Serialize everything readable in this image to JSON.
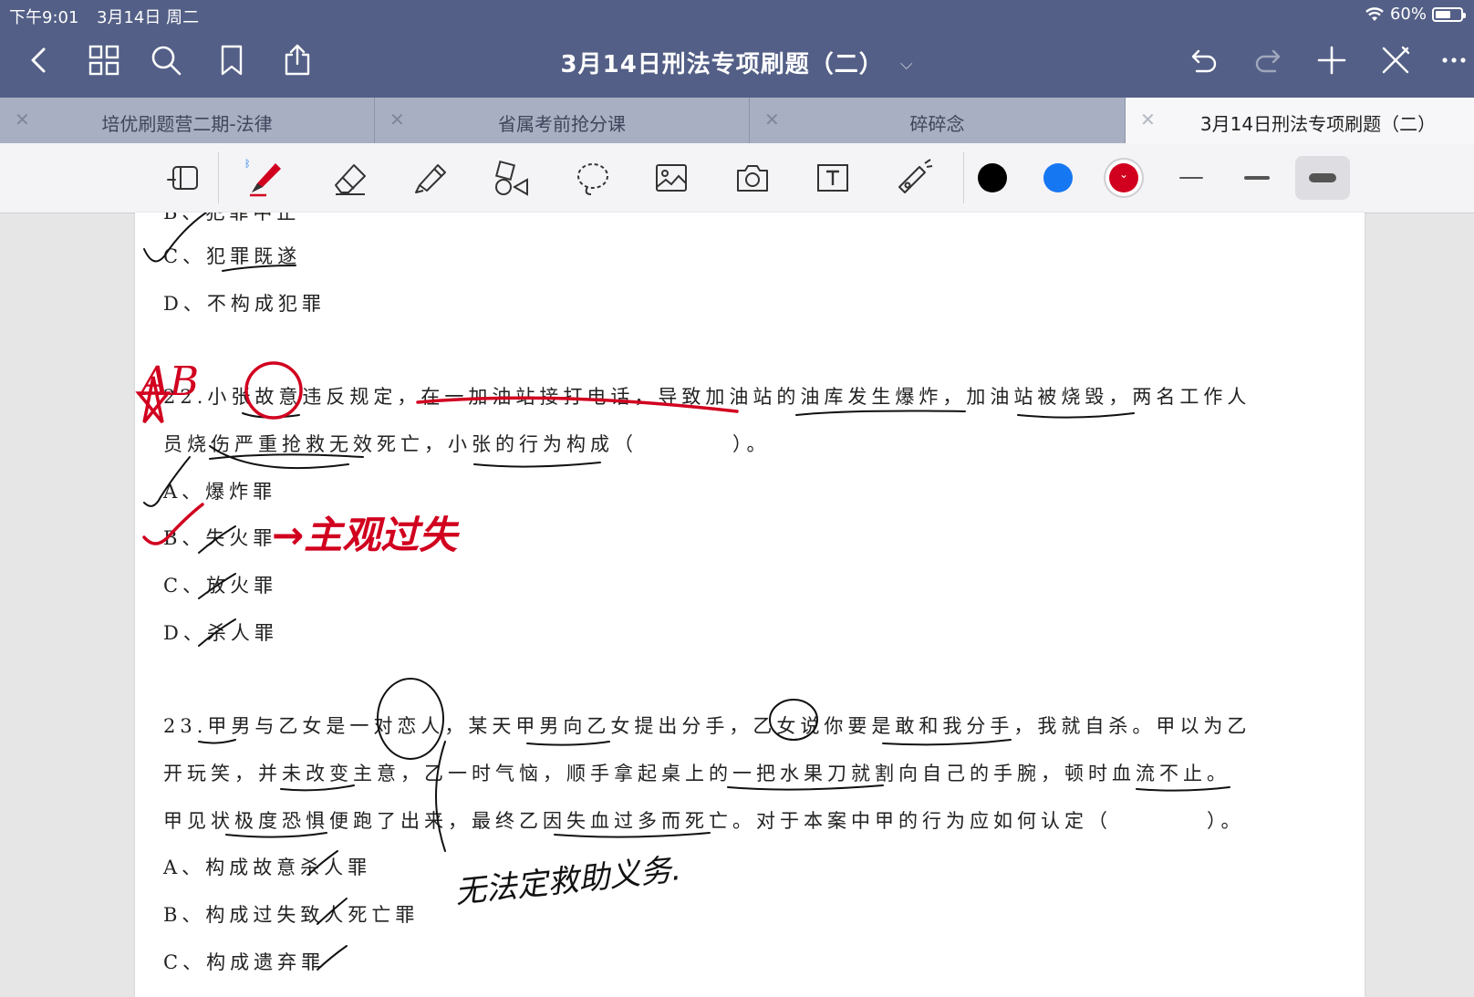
{
  "status": {
    "time": "下午9:01",
    "date": "3月14日 周二",
    "battery": "60%",
    "battery_level": 0.6
  },
  "header": {
    "title": "3月14日刑法专项刷题（二）",
    "title_chevron": "chevron-down-icon"
  },
  "nav_icons": [
    "back-icon",
    "grid-icon",
    "search-icon",
    "bookmark-icon",
    "share-icon",
    "undo-icon",
    "redo-icon",
    "add-icon",
    "close-pen-icon",
    "more-icon"
  ],
  "tabs": [
    {
      "label": "培优刷题营二期-法律",
      "active": false
    },
    {
      "label": "省属考前抢分课",
      "active": false
    },
    {
      "label": "碎碎念",
      "active": false
    },
    {
      "label": "3月14日刑法专项刷题（二）",
      "active": true
    }
  ],
  "tools": [
    "read-mode-icon",
    "pen-icon",
    "eraser-icon",
    "highlighter-icon",
    "shapes-icon",
    "lasso-icon",
    "image-icon",
    "camera-icon",
    "text-box-icon",
    "laser-pointer-icon"
  ],
  "colors": [
    {
      "name": "black",
      "hex": "#000000"
    },
    {
      "name": "blue",
      "hex": "#1677f2"
    },
    {
      "name": "red",
      "hex": "#d1001f",
      "selected": true
    }
  ],
  "stroke_widths": [
    "thin",
    "medium",
    "thick"
  ],
  "document": {
    "lines": [
      "B、犯罪中止",
      "C、犯罪既遂",
      "D、不构成犯罪",
      "22.小张故意违反规定，在一加油站接打电话，导致加油站的油库发生爆炸，加油站被烧毁，两名工作人",
      "员烧伤严重抢救无效死亡，小张的行为构成（　　　　）。",
      "A、爆炸罪",
      "B、失火罪",
      "C、放火罪",
      "D、杀人罪",
      "23.甲男与乙女是一对恋人，某天甲男向乙女提出分手，乙女说你要是敢和我分手，我就自杀。甲以为乙",
      "开玩笑，并未改变主意，乙一时气恼，顺手拿起桌上的一把水果刀就割向自己的手腕，顿时血流不止。",
      "甲见状极度恐惧便跑了出来，最终乙因失血过多而死亡。对于本案中甲的行为应如何认定（　　　　）。",
      "A、构成故意杀人罪",
      "B、构成过失致人死亡罪",
      "C、构成遗弃罪"
    ],
    "handwriting": {
      "answer_mark": "AB",
      "note_b": "→主观过失",
      "note_23": "无法定救助义务."
    }
  }
}
